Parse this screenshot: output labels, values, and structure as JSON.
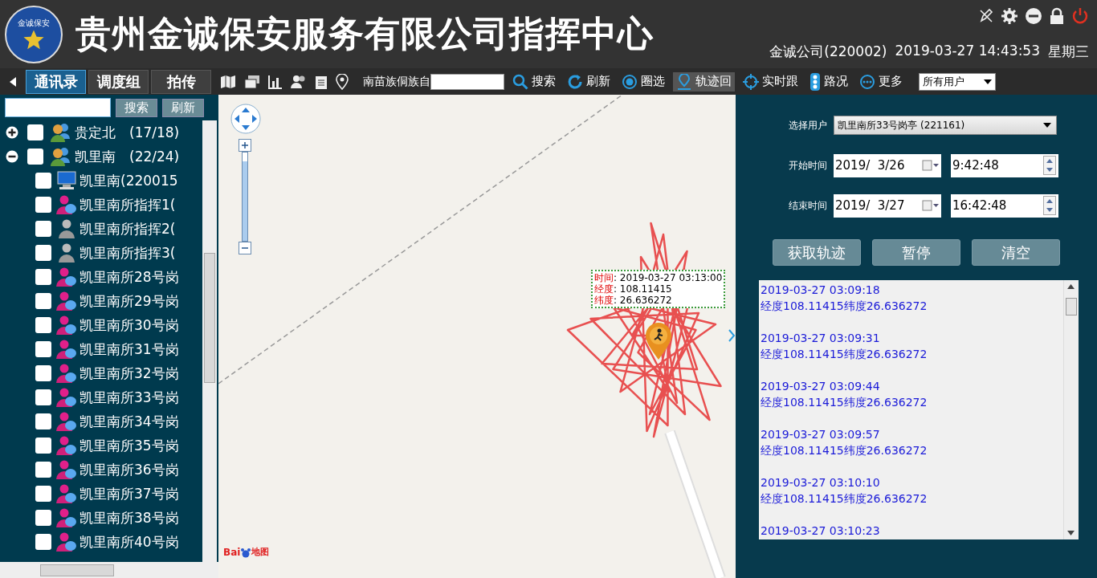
{
  "header": {
    "title": "贵州金诚保安服务有限公司指挥中心",
    "logo_text": "金诚保安",
    "company": "金诚公司(220002)",
    "datetime": "2019-03-27 14:43:53",
    "weekday": "星期三"
  },
  "tabs": [
    {
      "label": "通讯录",
      "selected": true
    },
    {
      "label": "调度组",
      "selected": false
    },
    {
      "label": "拍传",
      "selected": false
    }
  ],
  "toolbar": {
    "region_label": "南苗族侗族自",
    "actions": [
      {
        "label": "搜索",
        "kind": "search",
        "selected": false
      },
      {
        "label": "刷新",
        "kind": "refresh",
        "selected": false
      },
      {
        "label": "圈选",
        "kind": "circle",
        "selected": false
      },
      {
        "label": "轨迹回",
        "kind": "pin",
        "selected": true
      },
      {
        "label": "实时跟",
        "kind": "target",
        "selected": false
      },
      {
        "label": "路况",
        "kind": "traffic",
        "selected": false
      },
      {
        "label": "更多",
        "kind": "more",
        "selected": false
      }
    ],
    "user_filter": "所有用户"
  },
  "sidebar": {
    "buttons": [
      "搜索",
      "刷新"
    ],
    "tree": [
      {
        "label": "贵定北",
        "count": "(17/18)",
        "expanded": false,
        "checked": false
      },
      {
        "label": "凯里南",
        "count": "(22/24)",
        "expanded": true,
        "checked": false,
        "children": [
          {
            "label": "凯里南(220015",
            "kind": "terminal",
            "checked": false
          },
          {
            "label": "凯里南所指挥1(",
            "kind": "online",
            "checked": false
          },
          {
            "label": "凯里南所指挥2(",
            "kind": "offline",
            "checked": false
          },
          {
            "label": "凯里南所指挥3(",
            "kind": "offline",
            "checked": false
          },
          {
            "label": "凯里南所28号岗",
            "kind": "online",
            "checked": false
          },
          {
            "label": "凯里南所29号岗",
            "kind": "online",
            "checked": false
          },
          {
            "label": "凯里南所30号岗",
            "kind": "online",
            "checked": false
          },
          {
            "label": "凯里南所31号岗",
            "kind": "online",
            "checked": false
          },
          {
            "label": "凯里南所32号岗",
            "kind": "online",
            "checked": false
          },
          {
            "label": "凯里南所33号岗",
            "kind": "online",
            "checked": false
          },
          {
            "label": "凯里南所34号岗",
            "kind": "online",
            "checked": false
          },
          {
            "label": "凯里南所35号岗",
            "kind": "online",
            "checked": false
          },
          {
            "label": "凯里南所36号岗",
            "kind": "online",
            "checked": false
          },
          {
            "label": "凯里南所37号岗",
            "kind": "online",
            "checked": false
          },
          {
            "label": "凯里南所38号岗",
            "kind": "online",
            "checked": false
          },
          {
            "label": "凯里南所40号岗",
            "kind": "online",
            "checked": false
          }
        ]
      }
    ]
  },
  "map": {
    "zoom": {
      "level": 0.9
    },
    "tooltip": [
      {
        "key": "时间",
        "sep": ":",
        "value": "2019-03-27 03:13:00"
      },
      {
        "key": "经度",
        "sep": ":",
        "value": "108.11415"
      },
      {
        "key": "纬度",
        "sep": ":",
        "value": "26.636272"
      }
    ],
    "logo": [
      "Bai",
      "地图"
    ]
  },
  "track_panel": {
    "user_label": "选择用户",
    "user_value": "凯里南所33号岗亭 (221161)",
    "start_label": "开始时间",
    "start_date": "2019/  3/26",
    "start_time": "9:42:48",
    "end_label": "结束时间",
    "end_date": "2019/  3/27",
    "end_time": "16:42:48",
    "buttons": [
      "获取轨迹",
      "暂停",
      "清空"
    ],
    "log": [
      {
        "time": "2019-03-27 03:09:18",
        "coords": "经度108.11415纬度26.636272"
      },
      {
        "time": "2019-03-27 03:09:31",
        "coords": "经度108.11415纬度26.636272"
      },
      {
        "time": "2019-03-27 03:09:44",
        "coords": "经度108.11415纬度26.636272"
      },
      {
        "time": "2019-03-27 03:09:57",
        "coords": "经度108.11415纬度26.636272"
      },
      {
        "time": "2019-03-27 03:10:10",
        "coords": "经度108.11415纬度26.636272"
      },
      {
        "time": "2019-03-27 03:10:23"
      }
    ]
  }
}
